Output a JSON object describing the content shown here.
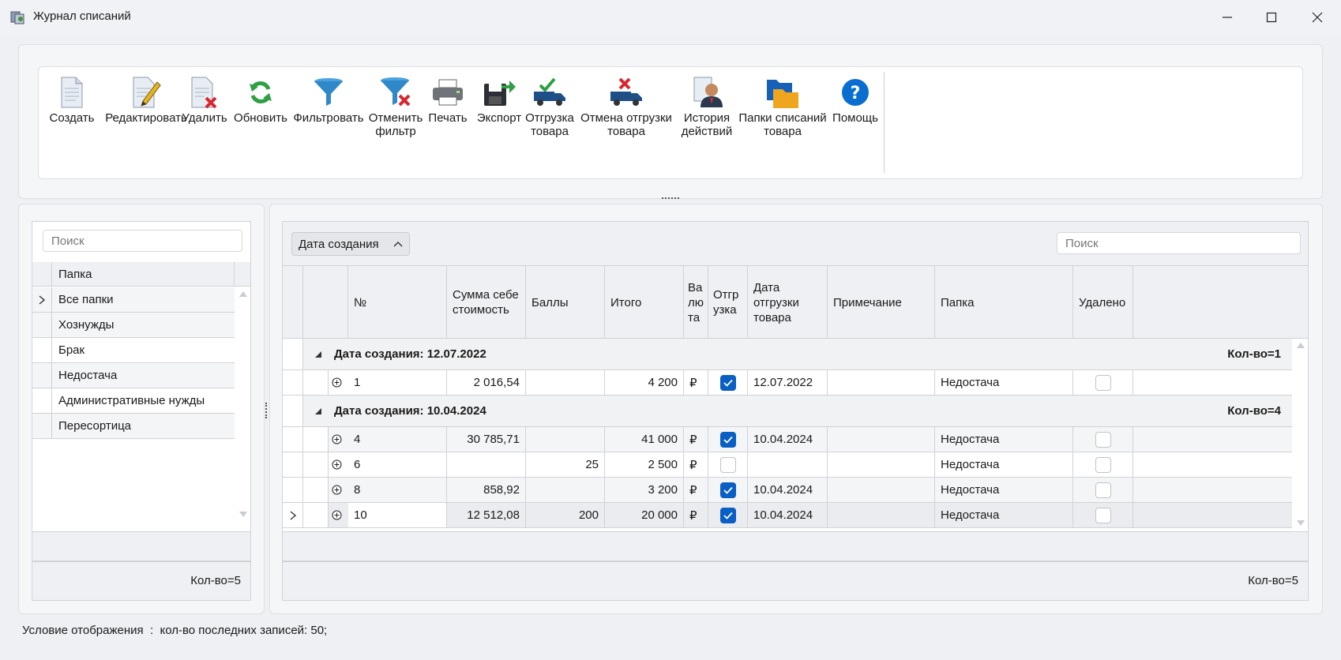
{
  "window": {
    "title": "Журнал списаний"
  },
  "ribbon": {
    "buttons": [
      {
        "line1": "Создать",
        "line2": "",
        "icon": "document-new-icon"
      },
      {
        "line1": "Редактировать",
        "line2": "",
        "icon": "document-edit-icon"
      },
      {
        "line1": "Удалить",
        "line2": "",
        "icon": "document-delete-icon"
      },
      {
        "line1": "Обновить",
        "line2": "",
        "icon": "refresh-icon"
      },
      {
        "line1": "Фильтровать",
        "line2": "",
        "icon": "filter-icon"
      },
      {
        "line1": "Отменить",
        "line2": "фильтр",
        "icon": "filter-cancel-icon"
      },
      {
        "line1": "Печать",
        "line2": "",
        "icon": "printer-icon"
      },
      {
        "line1": "Экспорт",
        "line2": "",
        "icon": "export-icon"
      },
      {
        "line1": "Отгрузка",
        "line2": "товара",
        "icon": "truck-check-icon"
      },
      {
        "line1": "Отмена отгрузки",
        "line2": "товара",
        "icon": "truck-cancel-icon"
      },
      {
        "line1": "История",
        "line2": "действий",
        "icon": "user-history-icon"
      },
      {
        "line1": "Папки списаний",
        "line2": "товара",
        "icon": "folders-icon"
      },
      {
        "line1": "Помощь",
        "line2": "",
        "icon": "help-icon"
      }
    ]
  },
  "left": {
    "search_placeholder": "Поиск",
    "column_header": "Папка",
    "folders": [
      "Все папки",
      "Хознужды",
      "Брак",
      "Недостача",
      "Административные нужды",
      "Пересортица"
    ],
    "count": "Кол-во=5"
  },
  "right": {
    "group_by_label": "Дата создания",
    "search_placeholder": "Поиск",
    "columns": {
      "num": "№",
      "cost": "Сумма себестоимость",
      "points": "Баллы",
      "total": "Итого",
      "currency": "Валюта",
      "shipment": "Отгрузка",
      "ship_date": "Дата отгрузки товара",
      "note": "Примечание",
      "folder": "Папка",
      "deleted": "Удалено"
    },
    "groups": [
      {
        "label": "Дата создания: 12.07.2022",
        "count": "Кол-во=1",
        "rows": [
          {
            "num": "1",
            "cost": "2 016,54",
            "points": "",
            "total": "4 200",
            "cur": "₽",
            "shipped": true,
            "date": "12.07.2022",
            "note": "",
            "folder": "Недостача",
            "deleted": false
          }
        ]
      },
      {
        "label": "Дата создания: 10.04.2024",
        "count": "Кол-во=4",
        "rows": [
          {
            "num": "4",
            "cost": "30 785,71",
            "points": "",
            "total": "41 000",
            "cur": "₽",
            "shipped": true,
            "date": "10.04.2024",
            "note": "",
            "folder": "Недостача",
            "deleted": false
          },
          {
            "num": "6",
            "cost": "",
            "points": "25",
            "total": "2 500",
            "cur": "₽",
            "shipped": false,
            "date": "",
            "note": "",
            "folder": "Недостача",
            "deleted": false
          },
          {
            "num": "8",
            "cost": "858,92",
            "points": "",
            "total": "3 200",
            "cur": "₽",
            "shipped": true,
            "date": "10.04.2024",
            "note": "",
            "folder": "Недостача",
            "deleted": false
          },
          {
            "num": "10",
            "cost": "12 512,08",
            "points": "200",
            "total": "20 000",
            "cur": "₽",
            "shipped": true,
            "date": "10.04.2024",
            "note": "",
            "folder": "Недостача",
            "deleted": false
          }
        ]
      }
    ],
    "count": "Кол-во=5"
  },
  "status": {
    "text": "Условие отображения  :  кол-во последних записей: 50;"
  },
  "colors": {
    "accent": "#0a5fc4",
    "help": "#0a6ed1",
    "green": "#2ea043",
    "red": "#d9262f"
  }
}
